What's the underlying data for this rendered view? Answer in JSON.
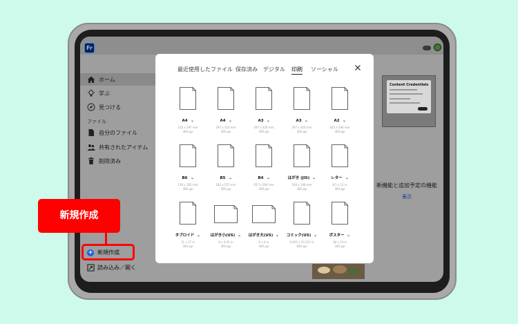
{
  "app": {
    "logo_text": "Fr"
  },
  "sidebar": {
    "items": [
      {
        "label": "ホーム",
        "icon": "home-icon",
        "active": true
      },
      {
        "label": "学ぶ",
        "icon": "lightbulb-icon"
      },
      {
        "label": "見つける",
        "icon": "compass-icon"
      }
    ],
    "section_files": "ファイル",
    "file_items": [
      {
        "label": "自分のファイル",
        "icon": "file-icon"
      },
      {
        "label": "共有されたアイテム",
        "icon": "people-icon"
      },
      {
        "label": "削除済み",
        "icon": "trash-icon"
      }
    ],
    "new_label": "新規作成",
    "import_label": "読み込み／開く"
  },
  "right_panel": {
    "feature_title": "新機能と追加予定の機能",
    "feature_link": "表示",
    "card_title": "Content Credentials"
  },
  "modal": {
    "tabs": [
      {
        "label": "最近使用したファイル",
        "active": false
      },
      {
        "label": "保存済み",
        "active": false
      },
      {
        "label": "デジタル",
        "active": false
      },
      {
        "label": "印刷",
        "active": true
      },
      {
        "label": "ソーシャル",
        "active": false
      }
    ],
    "papers": [
      {
        "name": "A4",
        "dim": "210 x 297 mm",
        "ppi": "300 ppi",
        "orient": "portrait"
      },
      {
        "name": "A4",
        "dim": "297 x 210 mm",
        "ppi": "300 ppi",
        "orient": "portrait"
      },
      {
        "name": "A3",
        "dim": "297 x 420 mm",
        "ppi": "300 ppi",
        "orient": "portrait"
      },
      {
        "name": "A3",
        "dim": "297 x 420 mm",
        "ppi": "300 ppi",
        "orient": "portrait"
      },
      {
        "name": "A2",
        "dim": "420 x 594 mm",
        "ppi": "300 ppi",
        "orient": "portrait"
      },
      {
        "name": "B6",
        "dim": "128 x 182 mm",
        "ppi": "300 ppi",
        "orient": "portrait"
      },
      {
        "name": "B5",
        "dim": "182 x 257 mm",
        "ppi": "300 ppi",
        "orient": "portrait"
      },
      {
        "name": "B4",
        "dim": "257 x 364 mm",
        "ppi": "300 ppi",
        "orient": "portrait"
      },
      {
        "name": "はがき (JIS)",
        "dim": "100 x 148 mm",
        "ppi": "300 ppi",
        "orient": "portrait"
      },
      {
        "name": "レター",
        "dim": "8.5 x 11 in",
        "ppi": "300 ppi",
        "orient": "portrait"
      },
      {
        "name": "タブロイド",
        "dim": "11 x 17 in",
        "ppi": "300 ppi",
        "orient": "portrait"
      },
      {
        "name": "はがき小(US)",
        "dim": "6 x 4.25 in",
        "ppi": "300 ppi",
        "orient": "landscape"
      },
      {
        "name": "はがき大(US)",
        "dim": "6 x 4 in",
        "ppi": "300 ppi",
        "orient": "landscape"
      },
      {
        "name": "コミック(US)",
        "dim": "6.625 x 10.125 in",
        "ppi": "600 ppi",
        "orient": "portrait"
      },
      {
        "name": "ポスター",
        "dim": "18 x 24 in",
        "ppi": "300 ppi",
        "orient": "portrait"
      }
    ]
  },
  "callout": {
    "text": "新規作成",
    "color": "#ff0000"
  }
}
